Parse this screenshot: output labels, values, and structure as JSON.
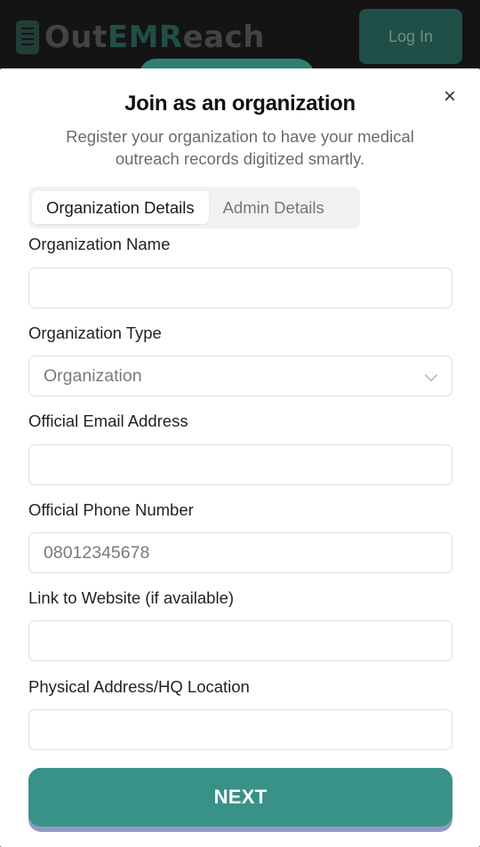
{
  "header": {
    "brand_part1": "Out",
    "brand_part2": "EMR",
    "brand_part3": "each",
    "login_label": "Log In"
  },
  "modal": {
    "title": "Join as an organization",
    "subtitle": "Register your organization to have your medical outreach records digitized smartly.",
    "close_icon": "×"
  },
  "tabs": [
    {
      "label": "Organization Details",
      "active": true
    },
    {
      "label": "Admin Details",
      "active": false
    }
  ],
  "form": {
    "org_name": {
      "label": "Organization Name",
      "value": ""
    },
    "org_type": {
      "label": "Organization Type",
      "selected": "Organization"
    },
    "email": {
      "label": "Official Email Address",
      "value": ""
    },
    "phone": {
      "label": "Official Phone Number",
      "placeholder": "08012345678"
    },
    "website": {
      "label": "Link to Website (if available)",
      "value": ""
    },
    "address": {
      "label": "Physical Address/HQ Location",
      "value": ""
    }
  },
  "next_label": "NEXT",
  "colors": {
    "accent": "#389287",
    "accent_shadow": "#8e99c4",
    "tab_bg": "#f1f1f1"
  }
}
